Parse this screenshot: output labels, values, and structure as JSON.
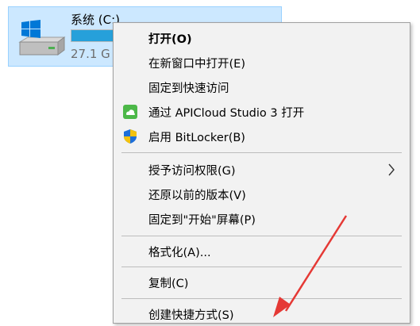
{
  "drive": {
    "name": "系统 (C:)",
    "size_text": "27.1 G",
    "used_fraction": 0.62,
    "icon": "windows-drive-icon"
  },
  "menu": {
    "items": [
      {
        "label": "打开(O)",
        "bold": true
      },
      {
        "label": "在新窗口中打开(E)"
      },
      {
        "label": "固定到快速访问"
      },
      {
        "label": "通过 APICloud Studio 3 打开",
        "icon": "apicloud-icon"
      },
      {
        "label": "启用 BitLocker(B)",
        "icon": "shield-icon"
      },
      {
        "label": "授予访问权限(G)",
        "submenu": true
      },
      {
        "label": "还原以前的版本(V)"
      },
      {
        "label": "固定到\"开始\"屏幕(P)"
      },
      {
        "label": "格式化(A)..."
      },
      {
        "label": "复制(C)"
      },
      {
        "label": "创建快捷方式(S)"
      }
    ]
  },
  "colors": {
    "selection": "#cce8ff",
    "drive_bar": "#26a0da",
    "annotation_arrow": "#e53935",
    "apicloud_green": "#4cb848"
  }
}
